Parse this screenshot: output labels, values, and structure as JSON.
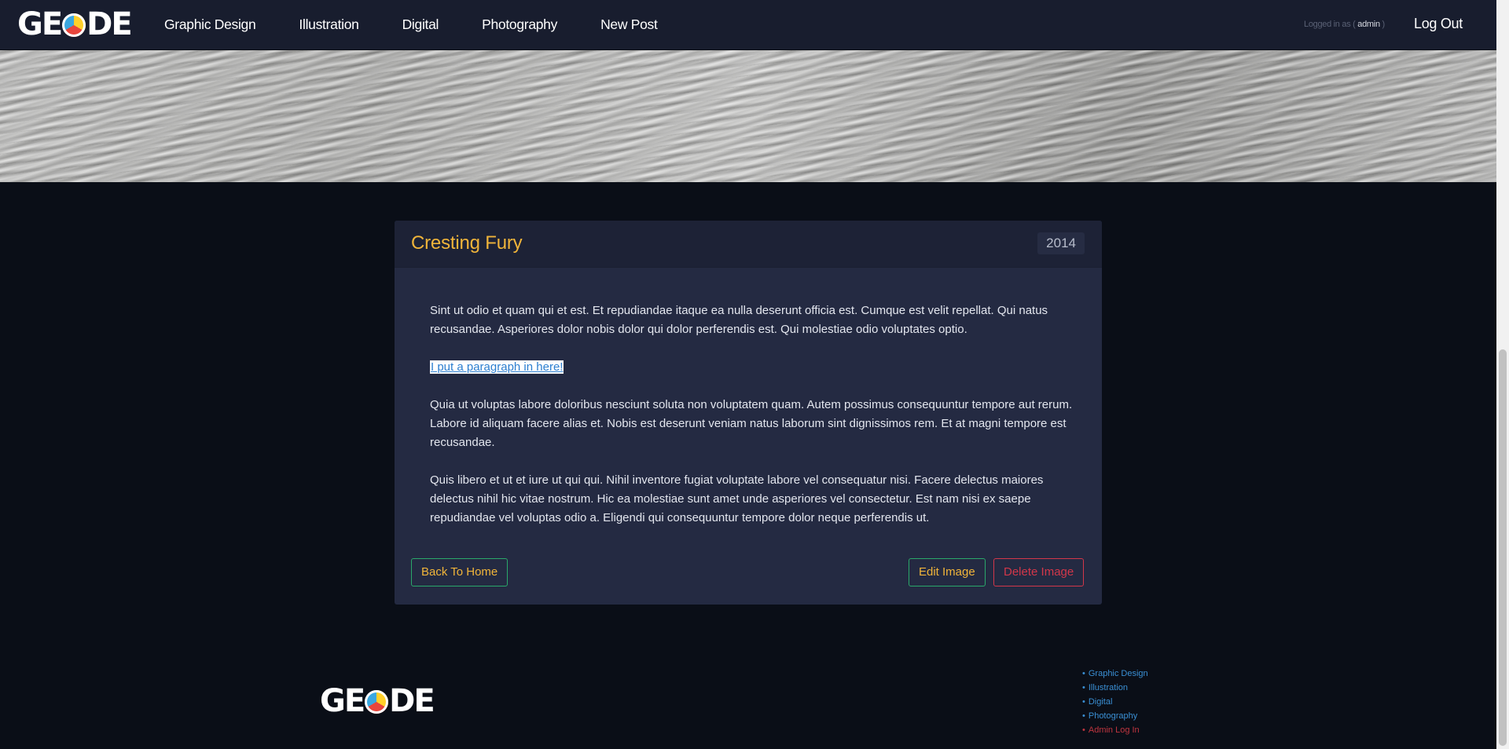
{
  "nav": {
    "logo": {
      "left": "GE",
      "right": "DE"
    },
    "links": [
      {
        "label": "Graphic Design"
      },
      {
        "label": "Illustration"
      },
      {
        "label": "Digital"
      },
      {
        "label": "Photography"
      },
      {
        "label": "New Post"
      }
    ],
    "logged_in_prefix": "Logged in as (",
    "user": "admin",
    "logged_in_suffix": ")",
    "logout": "Log Out"
  },
  "post": {
    "title": "Cresting Fury",
    "year": "2014",
    "paragraphs": [
      "Sint ut odio et quam qui et est. Et repudiandae itaque ea nulla deserunt officia est. Cumque est velit repellat. Qui natus recusandae. Asperiores dolor nobis dolor qui dolor perferendis est. Qui molestiae odio voluptates optio.",
      "I put a paragraph in here!",
      "Quia ut voluptas labore doloribus nesciunt soluta non voluptatem quam. Autem possimus consequuntur tempore aut rerum. Labore id aliquam facere alias et. Nobis est deserunt veniam natus laborum sint dignissimos rem. Et at magni tempore est recusandae.",
      "Quis libero et ut et iure ut qui qui. Nihil inventore fugiat voluptate labore vel consequatur nisi. Facere delectus maiores delectus nihil hic vitae nostrum. Hic ea molestiae sunt amet unde asperiores vel consectetur. Est nam nisi ex saepe repudiandae vel voluptas odio a. Eligendi qui consequuntur tempore dolor neque perferendis ut."
    ],
    "buttons": {
      "back": "Back To Home",
      "edit": "Edit Image",
      "delete": "Delete Image"
    }
  },
  "footer": {
    "logo": {
      "left": "GE",
      "right": "DE"
    },
    "links": [
      {
        "label": "Graphic Design"
      },
      {
        "label": "Illustration"
      },
      {
        "label": "Digital"
      },
      {
        "label": "Photography"
      },
      {
        "label": "Admin Log In"
      }
    ],
    "bullet": "•"
  },
  "colors": {
    "accent": "#f0b43a",
    "success": "#2aa86a",
    "danger": "#d2374a",
    "link": "#3a8fd4"
  }
}
